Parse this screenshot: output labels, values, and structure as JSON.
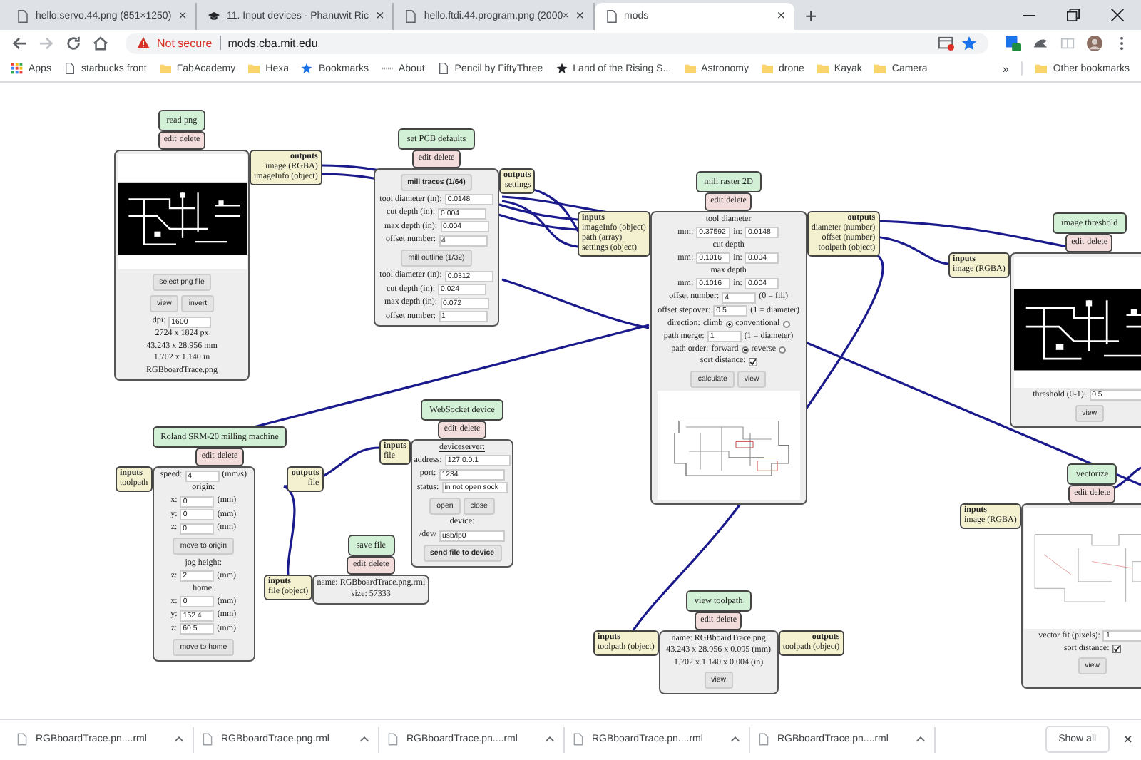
{
  "browser": {
    "tabs": [
      {
        "title": "hello.servo.44.png (851×1250)",
        "kind": "page",
        "selected": false,
        "close": "×"
      },
      {
        "title": "11. Input devices - Phanuwit Ric",
        "kind": "cap",
        "selected": false,
        "close": "×"
      },
      {
        "title": "hello.ftdi.44.program.png (2000×",
        "kind": "page",
        "selected": false,
        "close": "×"
      },
      {
        "title": "mods",
        "kind": "page",
        "selected": true,
        "close": "×"
      }
    ],
    "new_tab": "+",
    "security": "Not secure",
    "url": "mods.cba.mit.edu",
    "bookmarks": [
      {
        "label": "Apps",
        "kind": "apps"
      },
      {
        "label": "starbucks front",
        "kind": "page"
      },
      {
        "label": "FabAcademy",
        "kind": "folder"
      },
      {
        "label": "Hexa",
        "kind": "folder"
      },
      {
        "label": "Bookmarks",
        "kind": "star"
      },
      {
        "label": "About",
        "kind": "dots"
      },
      {
        "label": "Pencil by FiftyThree",
        "kind": "page"
      },
      {
        "label": "Land of the Rising S...",
        "kind": "blackstar"
      },
      {
        "label": "Astronomy",
        "kind": "folder"
      },
      {
        "label": "drone",
        "kind": "folder"
      },
      {
        "label": "Kayak",
        "kind": "folder"
      },
      {
        "label": "Camera",
        "kind": "folder"
      }
    ],
    "more_bookmarks": "»",
    "other_bookmarks": "Other bookmarks"
  },
  "modules": [
    {
      "title": "read png",
      "actions": [
        "edit",
        "delete"
      ],
      "outputs": {
        "heading": "outputs",
        "ports": [
          "image (RGBA)",
          "imageInfo (object)"
        ]
      },
      "rows": [
        {
          "kind": "picture"
        },
        {
          "kind": "button",
          "label": "select png file"
        },
        {
          "kind": "buttons",
          "labels": [
            "view",
            "invert"
          ]
        },
        {
          "kind": "field",
          "label": "dpi:",
          "value": "1600"
        },
        {
          "kind": "text",
          "text": "2724 x 1824 px"
        },
        {
          "kind": "text",
          "text": "43.243 x 28.956 mm"
        },
        {
          "kind": "text",
          "text": "1.702 x 1.140 in"
        },
        {
          "kind": "text",
          "text": "RGBboardTrace.png"
        }
      ]
    },
    {
      "title": "set PCB defaults",
      "actions": [
        "edit",
        "delete"
      ],
      "outputs": {
        "heading": "outputs",
        "ports": [
          "settings"
        ]
      },
      "rows": [
        {
          "kind": "button",
          "label": "mill traces (1/64)",
          "bold": true
        },
        {
          "kind": "field",
          "label": "tool diameter (in):",
          "value": "0.0148"
        },
        {
          "kind": "field",
          "label": "cut depth (in):",
          "value": "0.004"
        },
        {
          "kind": "field",
          "label": "max depth (in):",
          "value": "0.004"
        },
        {
          "kind": "field",
          "label": "offset number:",
          "value": "4"
        },
        {
          "kind": "button",
          "label": "mill outline (1/32)"
        },
        {
          "kind": "field",
          "label": "tool diameter (in):",
          "value": "0.0312"
        },
        {
          "kind": "field",
          "label": "cut depth (in):",
          "value": "0.024"
        },
        {
          "kind": "field",
          "label": "max depth (in):",
          "value": "0.072"
        },
        {
          "kind": "field",
          "label": "offset number:",
          "value": "1"
        }
      ]
    },
    {
      "title": "mill raster 2D",
      "actions": [
        "edit",
        "delete"
      ],
      "inputs": {
        "heading": "inputs",
        "ports": [
          "imageInfo (object)",
          "path (array)",
          "settings (object)"
        ]
      },
      "outputs": {
        "heading": "outputs",
        "ports": [
          "diameter (number)",
          "offset (number)",
          "toolpath (object)"
        ]
      },
      "rows": [
        {
          "kind": "text",
          "text": "tool diameter"
        },
        {
          "kind": "pair",
          "fields": [
            {
              "label": "mm:",
              "value": "0.37592"
            },
            {
              "label": "in:",
              "value": "0.0148"
            }
          ]
        },
        {
          "kind": "text",
          "text": "cut depth"
        },
        {
          "kind": "pair",
          "fields": [
            {
              "label": "mm:",
              "value": "0.1016"
            },
            {
              "label": "in:",
              "value": "0.004"
            }
          ]
        },
        {
          "kind": "text",
          "text": "max depth"
        },
        {
          "kind": "pair",
          "fields": [
            {
              "label": "mm:",
              "value": "0.1016"
            },
            {
              "label": "in:",
              "value": "0.004"
            }
          ]
        },
        {
          "kind": "field",
          "label": "offset number:",
          "value": "4",
          "unit": "(0 = fill)"
        },
        {
          "kind": "field",
          "label": "offset stepover:",
          "value": "0.5",
          "unit": "(1 = diameter)"
        },
        {
          "kind": "radio",
          "label": "direction:",
          "options": [
            {
              "label": "climb",
              "selected": true
            },
            {
              "label": "conventional",
              "selected": false
            }
          ]
        },
        {
          "kind": "field",
          "label": "path merge:",
          "value": "1",
          "unit": "(1 = diameter)"
        },
        {
          "kind": "radio",
          "label": "path order:",
          "options": [
            {
              "label": "forward",
              "selected": true
            },
            {
              "label": "reverse",
              "selected": false
            }
          ]
        },
        {
          "kind": "check",
          "label": "sort distance:",
          "checked": true
        },
        {
          "kind": "buttons",
          "labels": [
            "calculate",
            "view"
          ]
        },
        {
          "kind": "picture"
        }
      ]
    },
    {
      "title": "image threshold",
      "actions": [
        "edit",
        "delete"
      ],
      "inputs": {
        "heading": "inputs",
        "ports": [
          "image (RGBA)"
        ]
      },
      "rows": [
        {
          "kind": "picture"
        },
        {
          "kind": "field",
          "label": "threshold (0-1):",
          "value": "0.5"
        },
        {
          "kind": "button",
          "label": "view"
        }
      ]
    },
    {
      "title": "Roland SRM-20 milling machine",
      "actions": [
        "edit",
        "delete"
      ],
      "inputs": {
        "heading": "inputs",
        "ports": [
          "toolpath"
        ]
      },
      "outputs": {
        "heading": "outputs",
        "ports": [
          "file"
        ]
      },
      "rows": [
        {
          "kind": "field",
          "label": "speed:",
          "value": "4",
          "unit": "(mm/s)"
        },
        {
          "kind": "text",
          "text": "origin:"
        },
        {
          "kind": "field",
          "label": "x:",
          "value": "0",
          "unit": "(mm)"
        },
        {
          "kind": "field",
          "label": "y:",
          "value": "0",
          "unit": "(mm)"
        },
        {
          "kind": "field",
          "label": "z:",
          "value": "0",
          "unit": "(mm)"
        },
        {
          "kind": "button",
          "label": "move to origin"
        },
        {
          "kind": "text",
          "text": "jog height:"
        },
        {
          "kind": "field",
          "label": "z:",
          "value": "2",
          "unit": "(mm)"
        },
        {
          "kind": "text",
          "text": "home:"
        },
        {
          "kind": "field",
          "label": "x:",
          "value": "0",
          "unit": "(mm)"
        },
        {
          "kind": "field",
          "label": "y:",
          "value": "152.4",
          "unit": "(mm)"
        },
        {
          "kind": "field",
          "label": "z:",
          "value": "60.5",
          "unit": "(mm)"
        },
        {
          "kind": "button",
          "label": "move to home"
        }
      ]
    },
    {
      "title": "WebSocket device",
      "actions": [
        "edit",
        "delete"
      ],
      "inputs": {
        "heading": "inputs",
        "ports": [
          "file"
        ]
      },
      "rows": [
        {
          "kind": "text",
          "text": "deviceserver:",
          "underline": true
        },
        {
          "kind": "field",
          "label": "address:",
          "value": "127.0.0.1"
        },
        {
          "kind": "field",
          "label": "port:",
          "value": "1234"
        },
        {
          "kind": "field",
          "label": "status:",
          "value": "in not open sock"
        },
        {
          "kind": "buttons",
          "labels": [
            "open",
            "close"
          ]
        },
        {
          "kind": "text",
          "text": "device:"
        },
        {
          "kind": "field",
          "label": "/dev/",
          "value": "usb/lp0"
        },
        {
          "kind": "button",
          "label": "send file to device",
          "bold": true
        }
      ]
    },
    {
      "title": "save file",
      "actions": [
        "edit",
        "delete"
      ],
      "inputs": {
        "heading": "inputs",
        "ports": [
          "file (object)"
        ]
      },
      "rows": [
        {
          "kind": "text",
          "text": "name: RGBboardTrace.png.rml"
        },
        {
          "kind": "text",
          "text": "size: 57333"
        }
      ]
    },
    {
      "title": "view toolpath",
      "actions": [
        "edit",
        "delete"
      ],
      "inputs": {
        "heading": "inputs",
        "ports": [
          "toolpath (object)"
        ]
      },
      "outputs": {
        "heading": "outputs",
        "ports": [
          "toolpath (object)"
        ]
      },
      "rows": [
        {
          "kind": "text",
          "text": "name: RGBboardTrace.png"
        },
        {
          "kind": "text",
          "text": "43.243 x 28.956 x 0.095 (mm)"
        },
        {
          "kind": "text",
          "text": "1.702 x 1.140 x 0.004 (in)"
        },
        {
          "kind": "button",
          "label": "view"
        }
      ]
    },
    {
      "title": "vectorize",
      "actions": [
        "edit",
        "delete"
      ],
      "inputs": {
        "heading": "inputs",
        "ports": [
          "image (RGBA)"
        ]
      },
      "rows": [
        {
          "kind": "picture"
        },
        {
          "kind": "field",
          "label": "vector fit (pixels):",
          "value": "1"
        },
        {
          "kind": "check",
          "label": "sort distance:",
          "checked": true
        },
        {
          "kind": "button",
          "label": "view"
        }
      ]
    }
  ],
  "downloads": {
    "items": [
      "RGBboardTrace.pn....rml",
      "RGBboardTrace.png.rml",
      "RGBboardTrace.pn....rml",
      "RGBboardTrace.pn....rml",
      "RGBboardTrace.pn....rml"
    ],
    "show_all": "Show all",
    "close": "×"
  }
}
